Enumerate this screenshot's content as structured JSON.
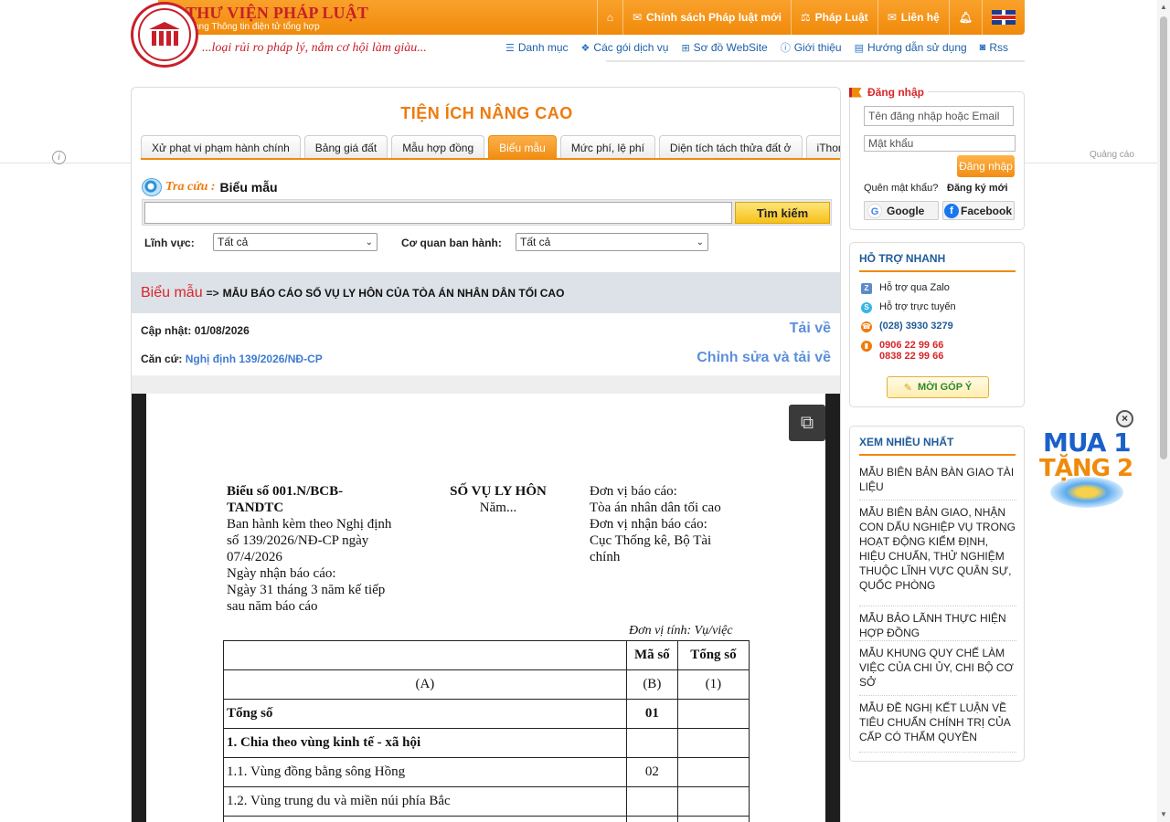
{
  "header": {
    "site_title": "THƯ VIỆN PHÁP LUẬT",
    "site_subtitle": "Trang Thông tin điện tử tổng hợp",
    "slogan": "...loại rủi ro pháp lý, nắm cơ hội làm giàu...",
    "top_nav": [
      {
        "label": "Chính sách Pháp luật mới",
        "icon": "mail-icon"
      },
      {
        "label": "Pháp Luật",
        "icon": "gavel-icon"
      },
      {
        "label": "Liên hệ",
        "icon": "envelope-icon"
      }
    ],
    "sub_nav": [
      {
        "label": "Danh mục",
        "icon": "list-icon"
      },
      {
        "label": "Các gói dịch vụ",
        "icon": "dropbox-icon"
      },
      {
        "label": "Sơ đồ WebSite",
        "icon": "sitemap-icon"
      },
      {
        "label": "Giới thiệu",
        "icon": "info-icon"
      },
      {
        "label": "Hướng dẫn sử dụng",
        "icon": "book-icon"
      },
      {
        "label": "Rss",
        "icon": "rss-icon"
      }
    ]
  },
  "side": {
    "ad_label": "Quảng cáo",
    "info_glyph": "i"
  },
  "main": {
    "title": "TIỆN ÍCH NÂNG CAO",
    "tabs": [
      {
        "label": "Xử phạt vi phạm hành chính",
        "active": false
      },
      {
        "label": "Bảng giá đất",
        "active": false
      },
      {
        "label": "Mẫu hợp đồng",
        "active": false
      },
      {
        "label": "Biểu mẫu",
        "active": true
      },
      {
        "label": "Mức phí, lệ phí",
        "active": false
      },
      {
        "label": "Diện tích tách thửa đất ở",
        "active": false
      },
      {
        "label": "iThong",
        "active": false
      }
    ],
    "search": {
      "prefix": "Tra cứu :",
      "category": "Biểu mẫu",
      "input_value": "",
      "button_label": "Tìm kiếm",
      "field_label": "Lĩnh vực:",
      "field_value": "Tất cả",
      "agency_label": "Cơ quan ban hành:",
      "agency_value": "Tất cả"
    },
    "breadcrumb": {
      "section": "Biểu mẫu",
      "arrow": "=>",
      "title": "MẪU BÁO CÁO SỐ VỤ LY HÔN CỦA TÒA ÁN NHÂN DÂN TỐI CAO"
    },
    "meta": {
      "updated_label": "Cập nhật:",
      "updated_value": "01/08/2026",
      "basis_label": "Căn cứ:",
      "basis_link": "Nghị định 139/2026/NĐ-CP",
      "download_label": "Tải về",
      "edit_download_label": "Chỉnh sửa và tải về"
    }
  },
  "document": {
    "left_lines": [
      "Biểu số 001.N/BCB-",
      "TANDTC",
      "Ban hành kèm theo Nghị định",
      "số 139/2026/NĐ-CP ngày",
      "07/4/2026",
      "Ngày nhận báo cáo:",
      "Ngày 31 tháng 3 năm kế tiếp",
      "sau năm báo cáo"
    ],
    "center_title": "SỐ VỤ LY HÔN",
    "center_sub": "Năm...",
    "right_lines": [
      "Đơn vị báo cáo:",
      "Tòa án nhân dân tối cao",
      "Đơn vị nhận báo cáo:",
      "Cục Thống kê, Bộ Tài",
      "chính"
    ],
    "unit": "Đơn vị tính: Vụ/việc",
    "table": {
      "header": [
        "",
        "Mã số",
        "Tổng số"
      ],
      "subheader": [
        "(A)",
        "(B)",
        "(1)"
      ],
      "rows": [
        {
          "label": "Tổng số",
          "code": "01",
          "total": "",
          "bold": true
        },
        {
          "label": "1. Chia theo vùng kinh tế - xã hội",
          "code": "",
          "total": "",
          "bold": true
        },
        {
          "label": "1.1. Vùng đồng bằng sông Hồng",
          "code": "02",
          "total": "",
          "bold": false
        },
        {
          "label": "1.2. Vùng trung du và miền núi phía Bắc",
          "code": "",
          "total": "",
          "bold": false
        },
        {
          "label": "",
          "code": "",
          "total": "",
          "bold": false
        }
      ]
    }
  },
  "login": {
    "title": "Đăng nhập",
    "username_placeholder": "Tên đăng nhập hoặc Email",
    "password_placeholder": "Mật khẩu",
    "login_button": "Đăng nhập",
    "forgot": "Quên mật khẩu?",
    "register": "Đăng ký mới",
    "google": "Google",
    "facebook": "Facebook"
  },
  "support": {
    "title": "HỖ TRỢ NHANH",
    "items": [
      {
        "label": "Hỗ trợ qua Zalo",
        "icon": "zalo-icon"
      },
      {
        "label": "Hỗ trợ trực tuyến",
        "icon": "skype-icon"
      },
      {
        "label": "(028) 3930 3279",
        "icon": "phone-icon"
      },
      {
        "label": "0906 22 99 66",
        "label2": "0838 22 99 66",
        "icon": "mobile-icon"
      }
    ],
    "feedback_button": "MỜI GÓP Ý"
  },
  "popular": {
    "title": "XEM NHIỀU NHẤT",
    "items": [
      "MẪU BIÊN BẢN BÀN GIAO TÀI LIỆU",
      "MẪU BIÊN BẢN GIAO, NHẬN CON DẤU NGHIỆP VỤ TRONG HOẠT ĐỘNG KIỂM ĐỊNH, HIỆU CHUẨN, THỬ NGHIỆM THUỘC LĨNH VỰC QUÂN SỰ, QUỐC PHÒNG",
      "MẪU BẢO LÃNH THỰC HIỆN HỢP ĐỒNG",
      "MẪU KHUNG QUY CHẾ LÀM VIỆC CỦA CHI ỦY, CHI BỘ CƠ SỞ",
      "MẪU ĐỀ NGHỊ KẾT LUẬN VỀ TIÊU CHUẨN CHÍNH TRỊ CỦA CẤP CÓ THẨM QUYỀN"
    ]
  },
  "promo": {
    "line1": "MUA 1",
    "line2": "TẶNG 2"
  },
  "colors": {
    "brand_orange": "#f08a0b",
    "brand_red": "#c8202a",
    "link_blue": "#5b8fdb",
    "heading_blue": "#1f5b9a"
  }
}
